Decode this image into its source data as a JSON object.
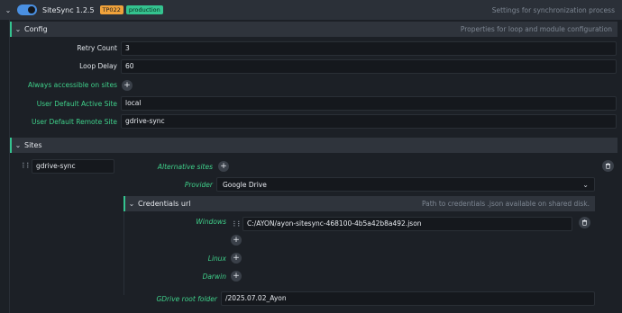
{
  "header": {
    "title": "SiteSync 1.2.5",
    "badge_project": "TP022",
    "badge_variant": "production",
    "description": "Settings for synchronization process"
  },
  "config": {
    "title": "Config",
    "description": "Properties for loop and module configuration",
    "retry_count_label": "Retry Count",
    "retry_count_value": "3",
    "loop_delay_label": "Loop Delay",
    "loop_delay_value": "60",
    "always_accessible_label": "Always accessible on sites",
    "active_site_label": "User Default Active Site",
    "active_site_value": "local",
    "remote_site_label": "User Default Remote Site",
    "remote_site_value": "gdrive-sync"
  },
  "sites": {
    "title": "Sites",
    "site_name": "gdrive-sync",
    "alternative_sites_label": "Alternative sites",
    "provider_label": "Provider",
    "provider_value": "Google Drive",
    "credentials": {
      "title": "Credentials url",
      "description": "Path to credentials .json available on shared disk.",
      "windows_label": "Windows",
      "windows_value": "C:/AYON/ayon-sitesync-468100-4b5a42b8a492.json",
      "linux_label": "Linux",
      "darwin_label": "Darwin"
    },
    "gdrive_root_label": "GDrive root folder",
    "gdrive_root_value": "/2025.07.02_Ayon"
  },
  "colors": {
    "accent_green": "#34c38f",
    "toggle_blue": "#4a90e2",
    "badge_orange": "#f0a23b"
  }
}
